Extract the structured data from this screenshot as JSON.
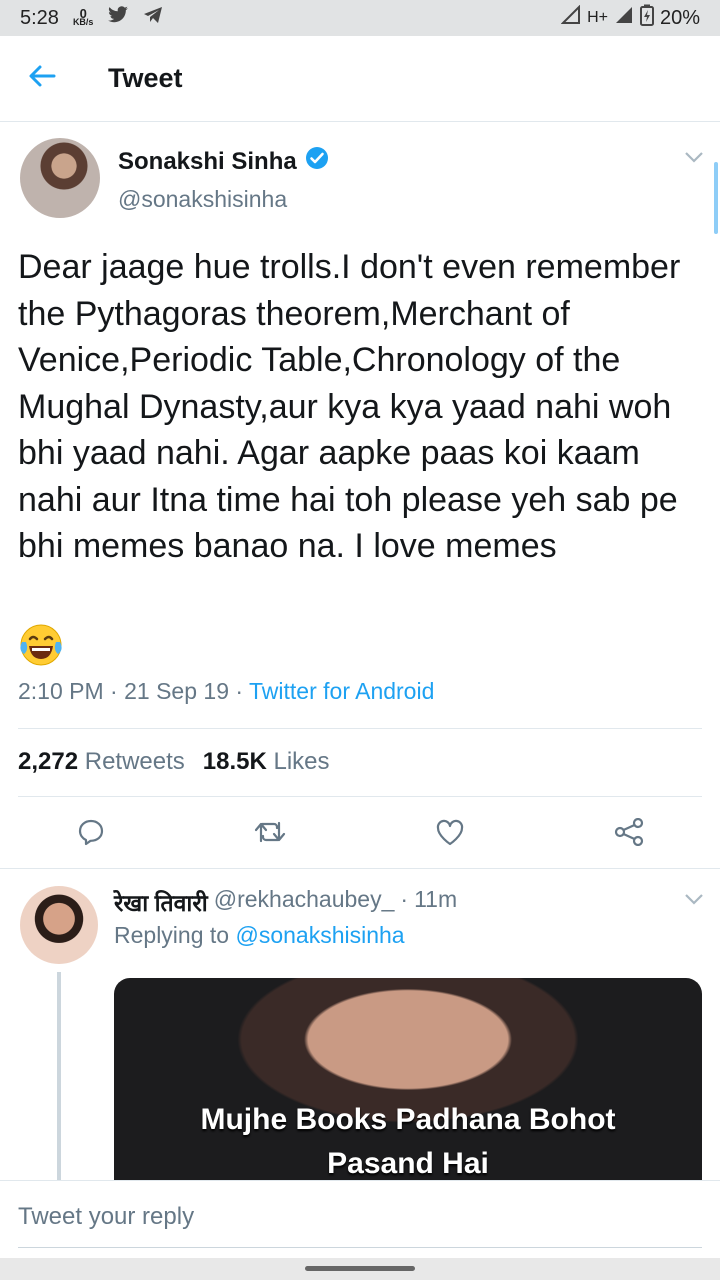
{
  "status_bar": {
    "time": "5:28",
    "net_speed_value": "0",
    "net_speed_unit": "KB/s",
    "network": "H+",
    "battery": "20%"
  },
  "header": {
    "title": "Tweet"
  },
  "tweet": {
    "name": "Sonakshi Sinha",
    "handle": "@sonakshisinha",
    "text": "Dear jaage hue trolls.I don't even remember the Pythagoras theorem,Merchant of Venice,Periodic Table,Chronology of the Mughal Dynasty,aur kya kya yaad nahi woh bhi yaad nahi. Agar aapke paas koi kaam nahi aur Itna time hai toh please yeh sab pe bhi memes banao na. I love memes",
    "time": "2:10 PM",
    "date": "21 Sep 19",
    "source": "Twitter for Android",
    "retweets_count": "2,272",
    "retweets_label": "Retweets",
    "likes_count": "18.5K",
    "likes_label": "Likes"
  },
  "reply": {
    "name": "रेखा तिवारी",
    "handle": "@rekhachaubey_",
    "age": "11m",
    "replying_prefix": "Replying to",
    "replying_handle": "@sonakshisinha",
    "media_caption_line1": "Mujhe Books Padhana Bohot",
    "media_caption_line2": "Pasand Hai"
  },
  "compose": {
    "placeholder": "Tweet your reply"
  },
  "colors": {
    "accent": "#1da1f2",
    "secondary_text": "#657786",
    "divider": "#e1e8ed"
  }
}
